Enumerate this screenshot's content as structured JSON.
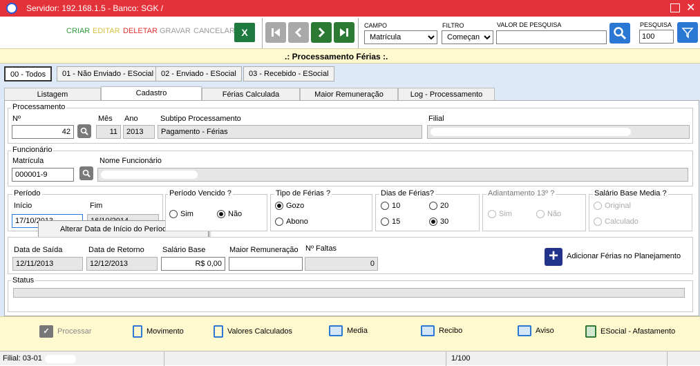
{
  "window": {
    "title": "Servidor: 192.168.1.5 - Banco: SGK /"
  },
  "toolbar": {
    "criar": "CRIAR",
    "editar": "EDITAR",
    "deletar": "DELETAR",
    "gravar": "GRAVAR",
    "cancelar": "CANCELAR",
    "campo_label": "CAMPO",
    "campo_value": "Matrícula",
    "filtro_label": "FILTRO",
    "filtro_value": "Começando",
    "valor_label": "VALOR DE PESQUISA",
    "valor_value": "",
    "pesquisa_label": "PESQUISA",
    "pesquisa_value": "100"
  },
  "page_title": ".: Processamento Férias :.",
  "status_tabs": [
    "00 - Todos",
    "01 - Não Enviado - ESocial",
    "02 - Enviado - ESocial",
    "03 - Recebido - ESocial"
  ],
  "view_tabs": [
    "Listagem",
    "Cadastro",
    "Férias Calculada",
    "Maior Remuneração",
    "Log - Processamento"
  ],
  "processamento": {
    "group": "Processamento",
    "n_label": "Nº",
    "n_value": "42",
    "mes_label": "Mês",
    "mes_value": "11",
    "ano_label": "Ano",
    "ano_value": "2013",
    "subtipo_label": "Subtipo Processamento",
    "subtipo_value": "Pagamento - Férias",
    "filial_label": "Filial"
  },
  "funcionario": {
    "group": "Funcionário",
    "matricula_label": "Matrícula",
    "matricula_value": "000001-9",
    "nome_label": "Nome Funcionário"
  },
  "periodo": {
    "group": "Período",
    "inicio_label": "Início",
    "inicio_value": "17/10/2013",
    "fim_label": "Fim",
    "fim_value": "16/10/2014"
  },
  "context_menu": {
    "item": "Alterar Data de Início do Período"
  },
  "periodo_vencido": {
    "group": "Período Vencido ?",
    "sim": "Sim",
    "nao": "Não"
  },
  "tipo_ferias": {
    "group": "Tipo de Férias ?",
    "gozo": "Gozo",
    "abono": "Abono"
  },
  "dias_ferias": {
    "group": "Dias de Férias?",
    "d10": "10",
    "d20": "20",
    "d15": "15",
    "d30": "30"
  },
  "adiantamento": {
    "group": "Adiantamento 13º ?",
    "sim": "Sim",
    "nao": "Não"
  },
  "salario_base_media": {
    "group": "Salário Base Media ?",
    "original": "Original",
    "calculado": "Calculado"
  },
  "datas": {
    "saida_label": "Data de Saída",
    "saida_value": "12/11/2013",
    "retorno_label": "Data de Retorno",
    "retorno_value": "12/12/2013",
    "salario_label": "Salário Base",
    "salario_value": "R$ 0,00",
    "maior_label": "Maior Remuneração",
    "maior_value": "",
    "faltas_label": "Nº Faltas",
    "faltas_value": "0",
    "adicionar": "Adicionar Férias no Planejamento"
  },
  "status": {
    "group": "Status"
  },
  "actions": {
    "processar": "Processar",
    "movimento": "Movimento",
    "valores": "Valores Calculados",
    "media": "Media",
    "recibo": "Recibo",
    "aviso": "Aviso",
    "esocial": "ESocial - Afastamento"
  },
  "statusbar": {
    "filial": "Filial: 03-01",
    "paging": "1/100"
  },
  "colors": {
    "title": "#e4323b",
    "nav": "#2d7a34",
    "blue": "#2a77d4"
  }
}
